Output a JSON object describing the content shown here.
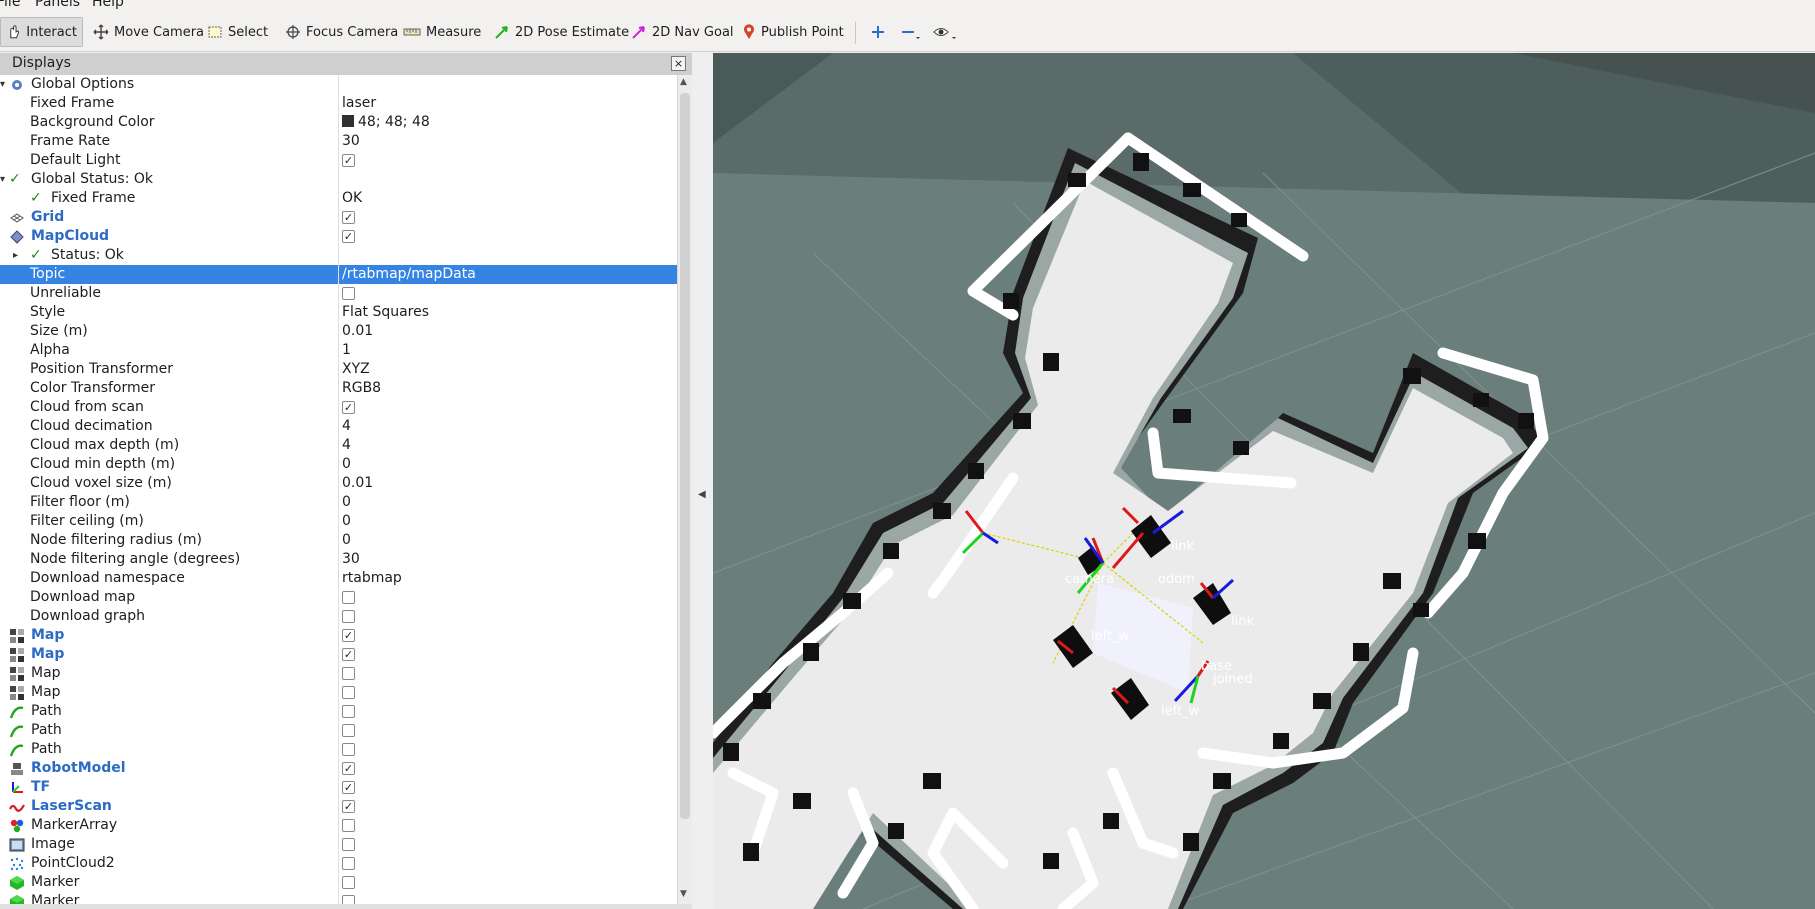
{
  "menubar": {
    "file": "File",
    "panels": "Panels",
    "help": "Help"
  },
  "toolbar": {
    "interact": "Interact",
    "move_camera": "Move Camera",
    "select": "Select",
    "focus_camera": "Focus Camera",
    "measure": "Measure",
    "pose_estimate": "2D Pose Estimate",
    "nav_goal": "2D Nav Goal",
    "publish_point": "Publish Point"
  },
  "displays": {
    "title": "Displays",
    "rows": [
      {
        "label": "Global Options",
        "icon": "gear-icon",
        "blue": false
      },
      {
        "label": "Fixed Frame",
        "value": "laser"
      },
      {
        "label": "Background Color",
        "value": "48; 48; 48",
        "swatch": "#303030"
      },
      {
        "label": "Frame Rate",
        "value": "30"
      },
      {
        "label": "Default Light",
        "checked": true
      },
      {
        "label": "Global Status: Ok",
        "status": "ok"
      },
      {
        "label": "Fixed Frame",
        "value": "OK",
        "status": "ok"
      },
      {
        "label": "Grid",
        "checked": true,
        "blue": true,
        "icon": "grid-icon"
      },
      {
        "label": "MapCloud",
        "checked": true,
        "blue": true,
        "icon": "mapcloud-icon"
      },
      {
        "label": "Status: Ok",
        "status": "ok"
      },
      {
        "label": "Topic",
        "value": "/rtabmap/mapData",
        "selected": true
      },
      {
        "label": "Unreliable",
        "checked": false
      },
      {
        "label": "Style",
        "value": "Flat Squares"
      },
      {
        "label": "Size (m)",
        "value": "0.01"
      },
      {
        "label": "Alpha",
        "value": "1"
      },
      {
        "label": "Position Transformer",
        "value": "XYZ"
      },
      {
        "label": "Color Transformer",
        "value": "RGB8"
      },
      {
        "label": "Cloud from scan",
        "checked": true
      },
      {
        "label": "Cloud decimation",
        "value": "4"
      },
      {
        "label": "Cloud max depth (m)",
        "value": "4"
      },
      {
        "label": "Cloud min depth (m)",
        "value": "0"
      },
      {
        "label": "Cloud voxel size (m)",
        "value": "0.01"
      },
      {
        "label": "Filter floor (m)",
        "value": "0"
      },
      {
        "label": "Filter ceiling (m)",
        "value": "0"
      },
      {
        "label": "Node filtering radius (m)",
        "value": "0"
      },
      {
        "label": "Node filtering angle (degrees)",
        "value": "30"
      },
      {
        "label": "Download namespace",
        "value": "rtabmap"
      },
      {
        "label": "Download map",
        "checked": false
      },
      {
        "label": "Download graph",
        "checked": false
      },
      {
        "label": "Map",
        "checked": true,
        "blue": true,
        "icon": "map-icon"
      },
      {
        "label": "Map",
        "checked": true,
        "blue": true,
        "icon": "map-icon"
      },
      {
        "label": "Map",
        "checked": false,
        "icon": "map-icon"
      },
      {
        "label": "Map",
        "checked": false,
        "icon": "map-icon"
      },
      {
        "label": "Path",
        "checked": false,
        "icon": "path-icon"
      },
      {
        "label": "Path",
        "checked": false,
        "icon": "path-icon"
      },
      {
        "label": "Path",
        "checked": false,
        "icon": "path-icon"
      },
      {
        "label": "RobotModel",
        "checked": true,
        "blue": true,
        "icon": "robot-model-icon"
      },
      {
        "label": "TF",
        "checked": true,
        "blue": true,
        "icon": "tf-icon"
      },
      {
        "label": "LaserScan",
        "checked": true,
        "blue": true,
        "icon": "laserscan-icon"
      },
      {
        "label": "MarkerArray",
        "checked": false,
        "icon": "marker-array-icon"
      },
      {
        "label": "Image",
        "checked": false,
        "icon": "image-icon"
      },
      {
        "label": "PointCloud2",
        "checked": false,
        "icon": "pointcloud2-icon"
      },
      {
        "label": "Marker",
        "checked": false,
        "icon": "marker-icon"
      },
      {
        "label": "Marker",
        "checked": false,
        "icon": "marker-icon"
      }
    ]
  },
  "viewport": {
    "frame_labels": [
      "camera",
      "odom",
      "link",
      "link",
      "left_w",
      "left_w",
      "base",
      "joined"
    ]
  },
  "colors": {
    "selection": "#3584e4",
    "enabled_label": "#2d6bc4",
    "background": "#303030",
    "viewport_grid": "#5c7370"
  }
}
